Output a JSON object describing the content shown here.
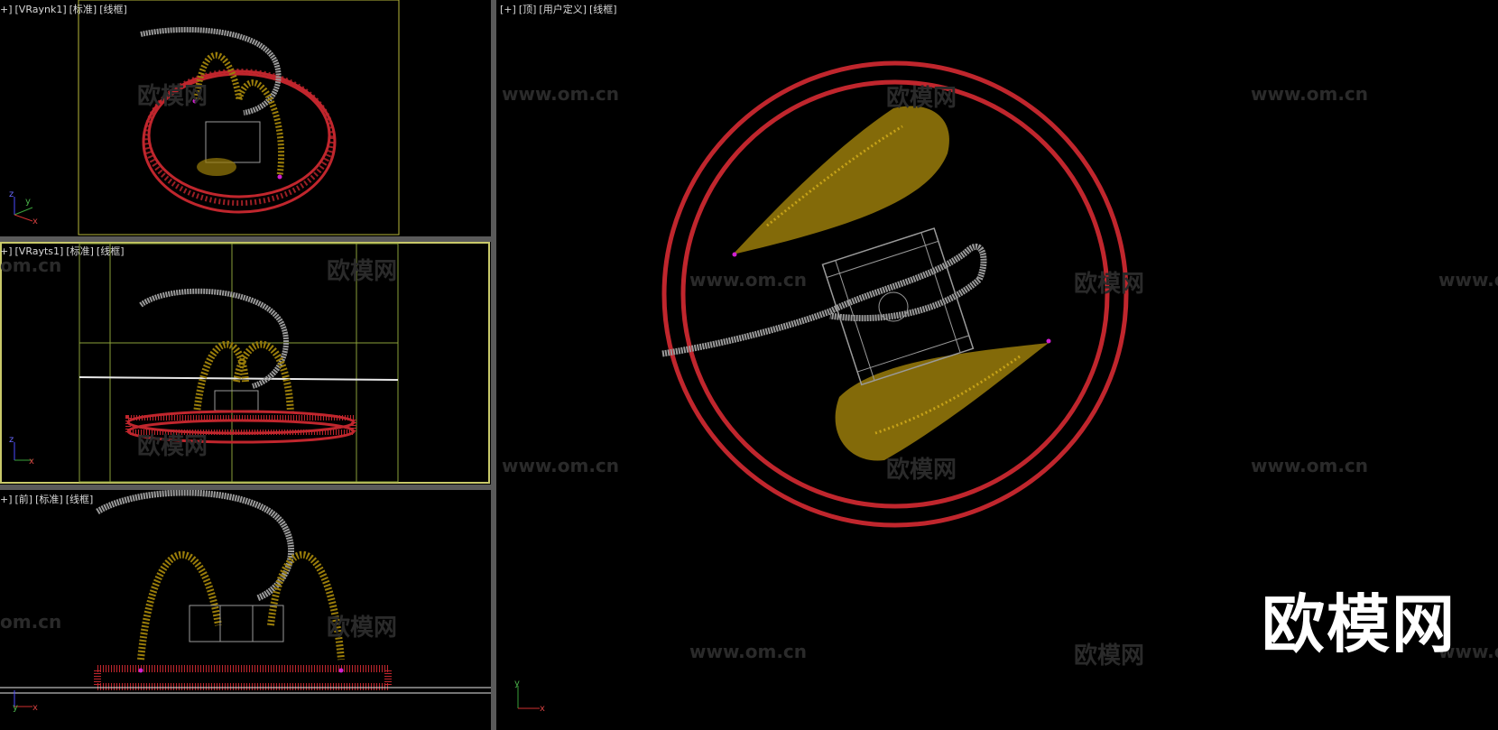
{
  "viewports": {
    "vraynk1": {
      "plus": "+]",
      "name": "[VRaynk1]",
      "mode": "[标准]",
      "shading": "[线框]"
    },
    "vrayts1": {
      "plus": "+]",
      "name": "[VRayts1]",
      "mode": "[标准]",
      "shading": "[线框]"
    },
    "front": {
      "plus": "+]",
      "name": "[前]",
      "mode": "[标准]",
      "shading": "[线框]"
    },
    "top": {
      "plus": "[+]",
      "name": "[顶]",
      "mode": "[用户定义]",
      "shading": "[线框]"
    }
  },
  "axis": {
    "x": "x",
    "y": "y",
    "z": "z"
  },
  "watermark": {
    "url": "www.om.cn",
    "brand": "欧模网",
    "url_cut": "www.o",
    "url_tail": "om.cn"
  },
  "logo": "欧模网",
  "colors": {
    "background": "#000000",
    "ring": "#c0262d",
    "particles": "#9a7d0a",
    "wire": "#9a9a9a",
    "camera": "#b8b83a",
    "divider": "#5a5a5a",
    "highlight": "#c9c96a"
  }
}
